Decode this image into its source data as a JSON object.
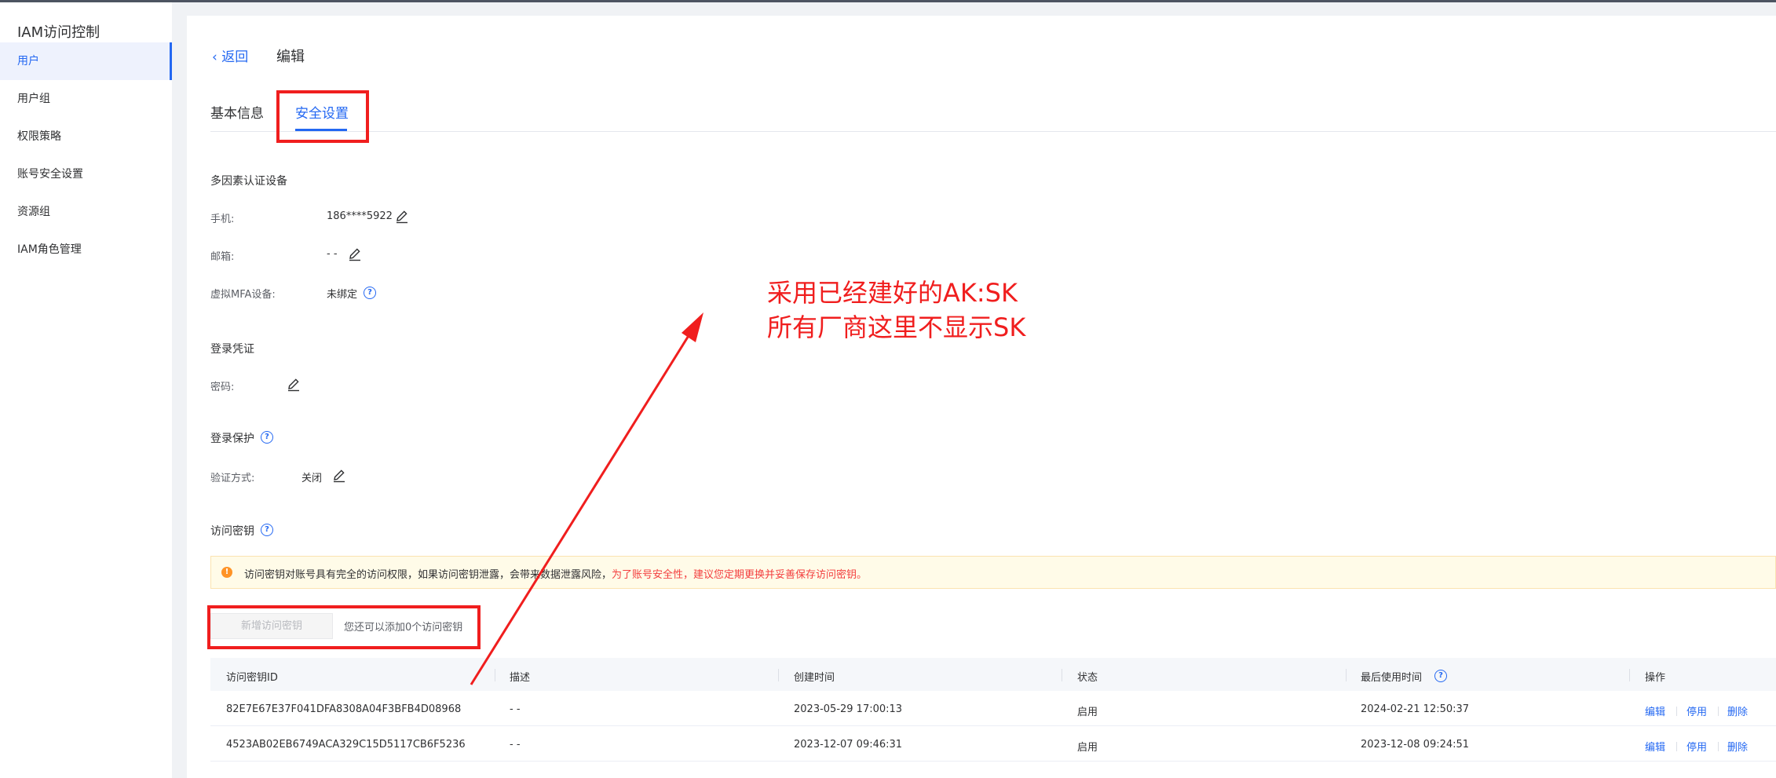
{
  "sidebar": {
    "title": "IAM访问控制",
    "items": [
      {
        "label": "用户"
      },
      {
        "label": "用户组"
      },
      {
        "label": "权限策略"
      },
      {
        "label": "账号安全设置"
      },
      {
        "label": "资源组"
      },
      {
        "label": "IAM角色管理"
      }
    ]
  },
  "header": {
    "back_label": "返回",
    "breadcrumb": "编辑"
  },
  "tabs": [
    {
      "label": "基本信息"
    },
    {
      "label": "安全设置"
    }
  ],
  "mfa": {
    "title": "多因素认证设备",
    "phone_label": "手机:",
    "phone_value": "186****5922",
    "email_label": "邮箱:",
    "email_value": "- -",
    "virtual_mfa_label": "虚拟MFA设备:",
    "virtual_mfa_value": "未绑定"
  },
  "login_credential": {
    "title": "登录凭证",
    "password_label": "密码:"
  },
  "login_protection": {
    "title": "登录保护",
    "method_label": "验证方式:",
    "method_value": "关闭"
  },
  "access_keys": {
    "title": "访问密钥",
    "warning_text": "访问密钥对账号具有完全的访问权限，如果访问密钥泄露，会带来数据泄露风险，",
    "warning_text_red": "为了账号安全性，建议您定期更换并妥善保存访问密钥。",
    "new_button": "新增访问密钥",
    "quota_hint": "您还可以添加0个访问密钥",
    "columns": [
      "访问密钥ID",
      "描述",
      "创建时间",
      "状态",
      "最后使用时间",
      "操作"
    ],
    "rows": [
      {
        "id": "82E7E67E37F041DFA8308A04F3BFB4D08968",
        "desc": "- -",
        "created": "2023-05-29 17:00:13",
        "status": "启用",
        "last_used": "2024-02-21 12:50:37"
      },
      {
        "id": "4523AB02EB6749ACA329C15D5117CB6F5236",
        "desc": "- -",
        "created": "2023-12-07 09:46:31",
        "status": "启用",
        "last_used": "2023-12-08 09:24:51"
      }
    ],
    "actions": {
      "edit": "编辑",
      "disable": "停用",
      "delete": "删除"
    }
  },
  "annotation": {
    "line1": "采用已经建好的AK:SK",
    "line2": "所有厂商这里不显示SK",
    "color": "#f01e1e"
  },
  "colors": {
    "accent": "#2468f2",
    "warning_bg": "#fffbe8",
    "warning_icon": "#ff9326",
    "warning_red": "#f33e3e"
  }
}
